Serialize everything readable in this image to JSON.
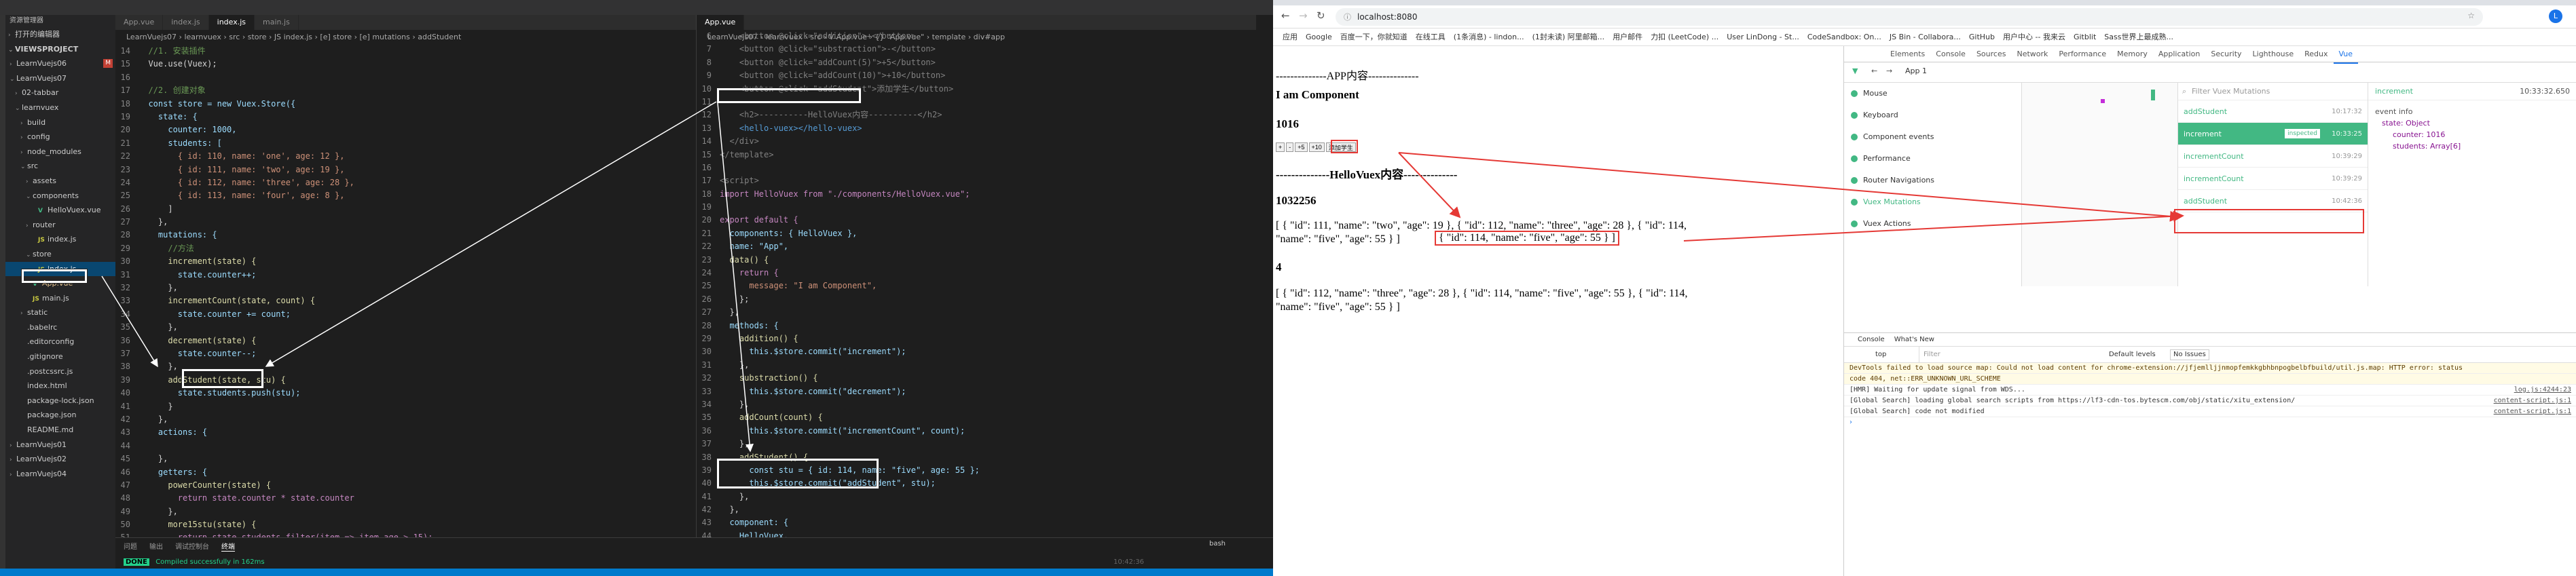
{
  "vscode": {
    "explorer_title": "资源管理器",
    "open_editors": "打开的编辑器",
    "workspace": "VIEWSPROJECT",
    "tree": [
      {
        "label": "LearnVuejs06",
        "depth": 0,
        "arrow": "›",
        "icon": "",
        "color": "#ccc",
        "badge": "M"
      },
      {
        "label": "LearnVuejs07",
        "depth": 0,
        "arrow": "⌄",
        "icon": "",
        "color": "#ccc"
      },
      {
        "label": "02-tabbar",
        "depth": 1,
        "arrow": "›",
        "icon": "",
        "color": "#ccc"
      },
      {
        "label": "learnvuex",
        "depth": 1,
        "arrow": "⌄",
        "icon": "",
        "color": "#ccc"
      },
      {
        "label": "build",
        "depth": 2,
        "arrow": "›",
        "icon": "",
        "color": "#ccc"
      },
      {
        "label": "config",
        "depth": 2,
        "arrow": "›",
        "icon": "",
        "color": "#ccc"
      },
      {
        "label": "node_modules",
        "depth": 2,
        "arrow": "›",
        "icon": "",
        "color": "#ccc"
      },
      {
        "label": "src",
        "depth": 2,
        "arrow": "⌄",
        "icon": "",
        "color": "#ccc"
      },
      {
        "label": "assets",
        "depth": 3,
        "arrow": "›",
        "icon": "",
        "color": "#ccc"
      },
      {
        "label": "components",
        "depth": 3,
        "arrow": "⌄",
        "icon": "",
        "color": "#ccc"
      },
      {
        "label": "HelloVuex.vue",
        "depth": 4,
        "arrow": "",
        "icon": "V",
        "color": "#ccc"
      },
      {
        "label": "router",
        "depth": 3,
        "arrow": "›",
        "icon": "",
        "color": "#ccc"
      },
      {
        "label": "index.js",
        "depth": 4,
        "arrow": "",
        "icon": "JS",
        "color": "#ccc"
      },
      {
        "label": "store",
        "depth": 3,
        "arrow": "⌄",
        "icon": "",
        "color": "#ccc"
      },
      {
        "label": "index.js",
        "depth": 4,
        "arrow": "",
        "icon": "JS",
        "color": "#fff",
        "selected": true
      },
      {
        "label": "App.vue",
        "depth": 3,
        "arrow": "",
        "icon": "V",
        "color": "#e2c08d"
      },
      {
        "label": "main.js",
        "depth": 3,
        "arrow": "",
        "icon": "JS",
        "color": "#ccc"
      },
      {
        "label": "static",
        "depth": 2,
        "arrow": "›",
        "icon": "",
        "color": "#ccc"
      },
      {
        "label": ".babelrc",
        "depth": 2,
        "arrow": "",
        "icon": "",
        "color": "#ccc"
      },
      {
        "label": ".editorconfig",
        "depth": 2,
        "arrow": "",
        "icon": "",
        "color": "#ccc"
      },
      {
        "label": ".gitignore",
        "depth": 2,
        "arrow": "",
        "icon": "",
        "color": "#ccc"
      },
      {
        "label": ".postcssrc.js",
        "depth": 2,
        "arrow": "",
        "icon": "",
        "color": "#ccc"
      },
      {
        "label": "index.html",
        "depth": 2,
        "arrow": "",
        "icon": "",
        "color": "#ccc"
      },
      {
        "label": "package-lock.json",
        "depth": 2,
        "arrow": "",
        "icon": "",
        "color": "#ccc"
      },
      {
        "label": "package.json",
        "depth": 2,
        "arrow": "",
        "icon": "",
        "color": "#ccc"
      },
      {
        "label": "README.md",
        "depth": 2,
        "arrow": "",
        "icon": "",
        "color": "#ccc"
      },
      {
        "label": "LearnVuejs01",
        "depth": 0,
        "arrow": "›",
        "icon": "",
        "color": "#ccc"
      },
      {
        "label": "LearnVuejs02",
        "depth": 0,
        "arrow": "›",
        "icon": "",
        "color": "#ccc"
      },
      {
        "label": "LearnVuejs04",
        "depth": 0,
        "arrow": "›",
        "icon": "",
        "color": "#ccc"
      }
    ],
    "editor1": {
      "tabs": [
        "App.vue",
        "index.js",
        "index.js",
        "main.js"
      ],
      "active_tab": 2,
      "breadcrumb": "LearnVuejs07 › learnvuex › src › store › JS index.js › [e] store › [e] mutations › addStudent",
      "lines": [
        {
          "n": "14",
          "t": "  //1. 安装插件",
          "c": "#6a9955"
        },
        {
          "n": "15",
          "t": "  Vue.use(Vuex);",
          "c": "#d4d4d4"
        },
        {
          "n": "16",
          "t": "",
          "c": "#d4d4d4"
        },
        {
          "n": "17",
          "t": "  //2. 创建对象",
          "c": "#6a9955"
        },
        {
          "n": "18",
          "t": "  const store = new Vuex.Store({",
          "c": "#9cdcfe"
        },
        {
          "n": "19",
          "t": "    state: {",
          "c": "#9cdcfe"
        },
        {
          "n": "20",
          "t": "      counter: 1000,",
          "c": "#9cdcfe"
        },
        {
          "n": "21",
          "t": "      students: [",
          "c": "#9cdcfe"
        },
        {
          "n": "22",
          "t": "        { id: 110, name: 'one', age: 12 },",
          "c": "#ce9178"
        },
        {
          "n": "23",
          "t": "        { id: 111, name: 'two', age: 19 },",
          "c": "#ce9178"
        },
        {
          "n": "24",
          "t": "        { id: 112, name: 'three', age: 28 },",
          "c": "#ce9178"
        },
        {
          "n": "25",
          "t": "        { id: 113, name: 'four', age: 8 },",
          "c": "#ce9178"
        },
        {
          "n": "26",
          "t": "      ]",
          "c": "#d4d4d4"
        },
        {
          "n": "27",
          "t": "    },",
          "c": "#d4d4d4"
        },
        {
          "n": "28",
          "t": "    mutations: {",
          "c": "#9cdcfe"
        },
        {
          "n": "29",
          "t": "      //方法",
          "c": "#6a9955"
        },
        {
          "n": "30",
          "t": "      increment(state) {",
          "c": "#dcdcaa"
        },
        {
          "n": "31",
          "t": "        state.counter++;",
          "c": "#9cdcfe"
        },
        {
          "n": "32",
          "t": "      },",
          "c": "#d4d4d4"
        },
        {
          "n": "33",
          "t": "      incrementCount(state, count) {",
          "c": "#dcdcaa"
        },
        {
          "n": "34",
          "t": "        state.counter += count;",
          "c": "#9cdcfe"
        },
        {
          "n": "35",
          "t": "      },",
          "c": "#d4d4d4"
        },
        {
          "n": "36",
          "t": "      decrement(state) {",
          "c": "#dcdcaa"
        },
        {
          "n": "37",
          "t": "        state.counter--;",
          "c": "#9cdcfe"
        },
        {
          "n": "38",
          "t": "      },",
          "c": "#d4d4d4"
        },
        {
          "n": "39",
          "t": "      addStudent(state, stu) {",
          "c": "#dcdcaa"
        },
        {
          "n": "40",
          "t": "        state.students.push(stu);",
          "c": "#9cdcfe"
        },
        {
          "n": "41",
          "t": "      }",
          "c": "#d4d4d4"
        },
        {
          "n": "42",
          "t": "    },",
          "c": "#d4d4d4"
        },
        {
          "n": "43",
          "t": "    actions: {",
          "c": "#9cdcfe"
        },
        {
          "n": "44",
          "t": "",
          "c": "#d4d4d4"
        },
        {
          "n": "45",
          "t": "    },",
          "c": "#d4d4d4"
        },
        {
          "n": "46",
          "t": "    getters: {",
          "c": "#9cdcfe"
        },
        {
          "n": "47",
          "t": "      powerCounter(state) {",
          "c": "#dcdcaa"
        },
        {
          "n": "48",
          "t": "        return state.counter * state.counter",
          "c": "#c586c0"
        },
        {
          "n": "49",
          "t": "      },",
          "c": "#d4d4d4"
        },
        {
          "n": "50",
          "t": "      more15stu(state) {",
          "c": "#dcdcaa"
        },
        {
          "n": "51",
          "t": "        return state.students.filter(item => item.age > 15);",
          "c": "#c586c0"
        }
      ]
    },
    "editor2": {
      "tabs": [
        "App.vue"
      ],
      "active_tab": 0,
      "breadcrumb": "LearnVuejs07 › learnvuex › src › V App.vue › {} \"App.vue\" › template › div#app",
      "lines": [
        {
          "n": "6",
          "t": "    <button @click=\"addition\">+</button>",
          "c": "#808080"
        },
        {
          "n": "7",
          "t": "    <button @click=\"substraction\">-</button>",
          "c": "#808080"
        },
        {
          "n": "8",
          "t": "    <button @click=\"addCount(5)\">+5</button>",
          "c": "#808080"
        },
        {
          "n": "9",
          "t": "    <button @click=\"addCount(10)\">+10</button>",
          "c": "#808080"
        },
        {
          "n": "10",
          "t": "    <button @click=\"addStudent\">添加学生</button>",
          "c": "#808080"
        },
        {
          "n": "11",
          "t": "",
          "c": "#d4d4d4"
        },
        {
          "n": "12",
          "t": "    <h2>----------HelloVuex内容----------</h2>",
          "c": "#808080"
        },
        {
          "n": "13",
          "t": "    <hello-vuex></hello-vuex>",
          "c": "#569cd6"
        },
        {
          "n": "14",
          "t": "  </div>",
          "c": "#808080"
        },
        {
          "n": "15",
          "t": "</template>",
          "c": "#808080"
        },
        {
          "n": "16",
          "t": "",
          "c": "#d4d4d4"
        },
        {
          "n": "17",
          "t": "<script>",
          "c": "#808080"
        },
        {
          "n": "18",
          "t": "import HelloVuex from \"./components/HelloVuex.vue\";",
          "c": "#c586c0"
        },
        {
          "n": "19",
          "t": "",
          "c": "#d4d4d4"
        },
        {
          "n": "20",
          "t": "export default {",
          "c": "#c586c0"
        },
        {
          "n": "21",
          "t": "  components: { HelloVuex },",
          "c": "#9cdcfe"
        },
        {
          "n": "22",
          "t": "  name: \"App\",",
          "c": "#9cdcfe"
        },
        {
          "n": "23",
          "t": "  data() {",
          "c": "#dcdcaa"
        },
        {
          "n": "24",
          "t": "    return {",
          "c": "#c586c0"
        },
        {
          "n": "25",
          "t": "      message: \"I am Component\",",
          "c": "#ce9178"
        },
        {
          "n": "26",
          "t": "    };",
          "c": "#d4d4d4"
        },
        {
          "n": "27",
          "t": "  },",
          "c": "#d4d4d4"
        },
        {
          "n": "28",
          "t": "  methods: {",
          "c": "#9cdcfe"
        },
        {
          "n": "29",
          "t": "    addition() {",
          "c": "#dcdcaa"
        },
        {
          "n": "30",
          "t": "      this.$store.commit(\"increment\");",
          "c": "#9cdcfe"
        },
        {
          "n": "31",
          "t": "    },",
          "c": "#d4d4d4"
        },
        {
          "n": "32",
          "t": "    substraction() {",
          "c": "#dcdcaa"
        },
        {
          "n": "33",
          "t": "      this.$store.commit(\"decrement\");",
          "c": "#9cdcfe"
        },
        {
          "n": "34",
          "t": "    },",
          "c": "#d4d4d4"
        },
        {
          "n": "35",
          "t": "    addCount(count) {",
          "c": "#dcdcaa"
        },
        {
          "n": "36",
          "t": "      this.$store.commit(\"incrementCount\", count);",
          "c": "#9cdcfe"
        },
        {
          "n": "37",
          "t": "    },",
          "c": "#d4d4d4"
        },
        {
          "n": "38",
          "t": "    addStudent() {",
          "c": "#dcdcaa"
        },
        {
          "n": "39",
          "t": "      const stu = { id: 114, name: \"five\", age: 55 };",
          "c": "#9cdcfe"
        },
        {
          "n": "40",
          "t": "      this.$store.commit(\"addStudent\", stu);",
          "c": "#9cdcfe"
        },
        {
          "n": "41",
          "t": "    },",
          "c": "#d4d4d4"
        },
        {
          "n": "42",
          "t": "  },",
          "c": "#d4d4d4"
        },
        {
          "n": "43",
          "t": "  component: {",
          "c": "#9cdcfe"
        },
        {
          "n": "44",
          "t": "    HelloVuex,",
          "c": "#9cdcfe"
        }
      ]
    },
    "panel": {
      "tabs": [
        "问题",
        "输出",
        "调试控制台",
        "终端"
      ],
      "terminal_select": "bash",
      "status": "DONE",
      "message": "Compiled successfully in 162ms",
      "time": "10:42:36"
    }
  },
  "chrome": {
    "url": "localhost:8080",
    "bookmarks": [
      "应用",
      "Google",
      "百度一下，你就知道",
      "在线工具",
      "(1条消息) - lindon...",
      "(1封未读) 阿里邮箱...",
      "用户邮件",
      "力扣 (LeetCode) ...",
      "User LinDong - St...",
      "CodeSandbox: On...",
      "JS Bin - Collabora...",
      "GitHub",
      "用户中心 -- 我来云",
      "Gitblit",
      "Sass世界上最成熟..."
    ],
    "page": {
      "app_heading": "--------------APP内容--------------",
      "message": "I am Component",
      "counter": "1016",
      "buttons": [
        "+",
        "-",
        "+5",
        "+10",
        "添加学生"
      ],
      "hello_heading": "--------------HelloVuex内容--------------",
      "power": "1032256",
      "students_line1": "[ { \"id\": 111, \"name\": \"two\", \"age\": 19 }, { \"id\": 112, \"name\": \"three\", \"age\": 28 }, { \"id\": 114,",
      "students_line2_pre": "\"name\": \"five\", \"age\": 55 } ]",
      "students_line2_box": "{ \"id\": 114, \"name\": \"five\", \"age\": 55 } ]",
      "count": "4",
      "filtered_line1": "[ { \"id\": 112, \"name\": \"three\", \"age\": 28 }, { \"id\": 114, \"name\": \"five\", \"age\": 55 }, { \"id\": 114,",
      "filtered_line2": "\"name\": \"five\", \"age\": 55 } ]"
    },
    "devtools": {
      "tabs": [
        "Elements",
        "Console",
        "Sources",
        "Network",
        "Performance",
        "Memory",
        "Application",
        "Security",
        "Lighthouse",
        "Redux",
        "Vue"
      ],
      "app_selector": "App 1",
      "vue_menu": [
        "Mouse",
        "Keyboard",
        "Component events",
        "Performance",
        "Router Navigations",
        "Vuex Mutations",
        "Vuex Actions"
      ],
      "filter_placeholder": "Filter Vuex Mutations",
      "mutations": [
        {
          "name": "addStudent",
          "time": "10:17:32"
        },
        {
          "name": "increment",
          "time": "10:33:25",
          "badge": "inspected"
        },
        {
          "name": "incrementCount",
          "time": "10:39:29"
        },
        {
          "name": "incrementCount",
          "time": "10:39:29"
        },
        {
          "name": "addStudent",
          "time": "10:42:36"
        }
      ],
      "inspector": {
        "name": "increment",
        "time": "10:33:32.650",
        "event_info": "event info",
        "state_label": "state: Object",
        "counter": "counter: 1016",
        "students": "students: Array[6]"
      },
      "console": {
        "tabs": [
          "Console",
          "What's New"
        ],
        "context": "top",
        "filter_placeholder": "Filter",
        "levels": "Default levels",
        "issues": "No Issues",
        "lines": [
          {
            "t": "DevTools failed to load source map: Could not load content for chrome-extension://jfjemlljjnmopfemkkgbhbnpogbelbfbuild/util.js.map: HTTP error: status",
            "src": "",
            "warn": true
          },
          {
            "t": "code 404, net::ERR_UNKNOWN_URL_SCHEME",
            "src": "",
            "warn": true
          },
          {
            "t": "[HMR] Waiting for update signal from WDS...",
            "src": "log.js:4244:23",
            "warn": false
          },
          {
            "t": "[Global Search] loading global search scripts from https://lf3-cdn-tos.bytescm.com/obj/static/xitu_extension/",
            "src": "content-script.js:1",
            "warn": false
          },
          {
            "t": "[Global Search] code not modified",
            "src": "content-script.js:1",
            "warn": false
          }
        ]
      }
    }
  }
}
